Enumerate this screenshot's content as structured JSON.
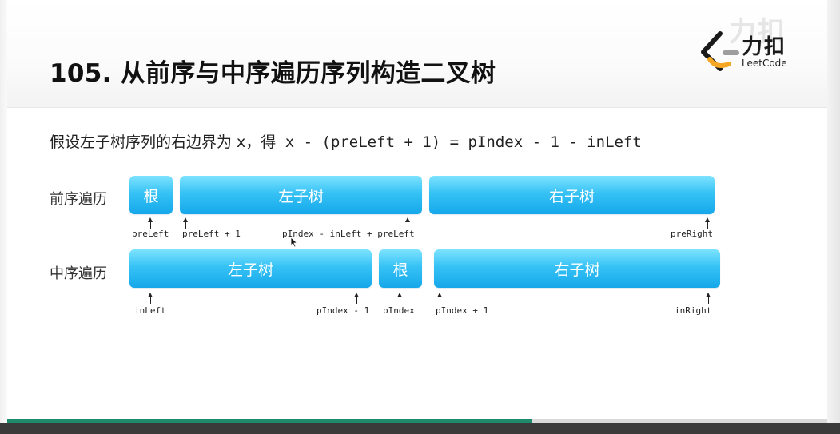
{
  "title": "105. 从前序与中序遍历序列构造二叉树",
  "logo": {
    "cn": "力扣",
    "en": "LeetCode",
    "watermark": "力扣"
  },
  "formula": {
    "prefix": "假设左子树序列的右边界为 x，得",
    "expr": " x -  (preLeft + 1) = pIndex - 1 - inLeft"
  },
  "preorder": {
    "label": "前序遍历",
    "segments": [
      "根",
      "左子树",
      "右子树"
    ],
    "pointers": [
      "preLeft",
      "preLeft + 1",
      "pIndex - inLeft + preLeft",
      "preRight"
    ]
  },
  "inorder": {
    "label": "中序遍历",
    "segments": [
      "左子树",
      "根",
      "右子树"
    ],
    "pointers": [
      "inLeft",
      "pIndex - 1",
      "pIndex",
      "pIndex + 1",
      "inRight"
    ]
  },
  "colors": {
    "segment_top": "#7ee3ff",
    "segment_bottom": "#15a7ea",
    "progress": "#1f8a6b"
  },
  "progress": 0.64
}
